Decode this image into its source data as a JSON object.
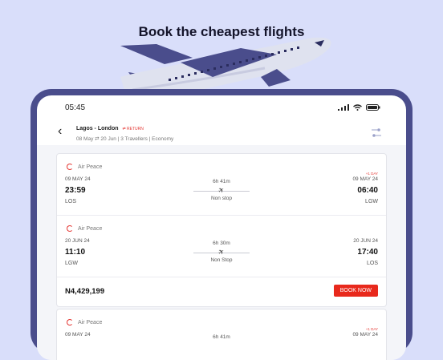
{
  "headline": "Book the cheapest flights",
  "status": {
    "time": "05:45"
  },
  "search": {
    "route": "Lagos - London",
    "trip_type": "RETURN",
    "date": "08 May",
    "return_date": "20 Jun",
    "travellers": "3 Travellers",
    "cabin": "Economy",
    "icons": {
      "back": "chevron-left-icon",
      "filter": "filter-icon"
    }
  },
  "results": [
    {
      "legs": [
        {
          "airline": "Air Peace",
          "dep_date": "09 MAY 24",
          "dep_time": "23:59",
          "dep_code": "LOS",
          "duration": "6h 41m",
          "stops": "Non stop",
          "arr_date": "09 MAY 24",
          "arr_time": "06:40",
          "arr_code": "LGW",
          "next_day": "+1 DAY"
        },
        {
          "airline": "Air Peace",
          "dep_date": "20 JUN 24",
          "dep_time": "11:10",
          "dep_code": "LGW",
          "duration": "6h 30m",
          "stops": "Non Stop",
          "arr_date": "20 JUN 24",
          "arr_time": "17:40",
          "arr_code": "LOS",
          "next_day": ""
        }
      ],
      "price": "N4,429,199",
      "book_label": "BOOK NOW"
    },
    {
      "legs": [
        {
          "airline": "Air Peace",
          "dep_date": "09 MAY 24",
          "dep_time": "",
          "dep_code": "",
          "duration": "6h 41m",
          "stops": "",
          "arr_date": "09 MAY 24",
          "arr_time": "",
          "arr_code": "",
          "next_day": "+1 DAY"
        }
      ],
      "price": "",
      "book_label": ""
    }
  ],
  "colors": {
    "accent": "#e8291c",
    "frame": "#4a4d8c",
    "background": "#d9defa"
  }
}
